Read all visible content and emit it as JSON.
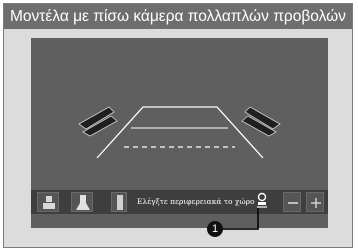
{
  "title": "Μοντέλα με πίσω κάμερα πολλαπλών προβολών",
  "toolbar": {
    "hint": "Ελέγξτε περιφερειακά το χώρο",
    "buttons": [
      {
        "icon": "view-mode-1-icon"
      },
      {
        "icon": "view-mode-2-icon"
      },
      {
        "icon": "view-mode-3-icon"
      },
      {
        "icon": "camera-guideline-toggle-icon"
      },
      {
        "icon": "minus-icon"
      },
      {
        "icon": "plus-icon"
      }
    ]
  },
  "callout": {
    "number": "1"
  },
  "colors": {
    "title_bg": "#6e6e6e",
    "screen_bg": "#5f5f5f",
    "guide": "#ffffff",
    "warning_chevron": "#1f1f1f"
  }
}
